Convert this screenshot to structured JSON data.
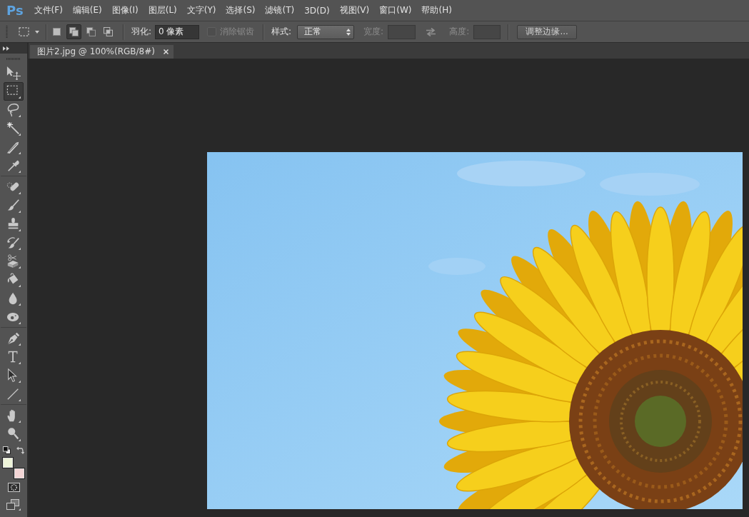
{
  "menu_bar": {
    "logo": "Ps",
    "items": [
      "文件(F)",
      "编辑(E)",
      "图像(I)",
      "图层(L)",
      "文字(Y)",
      "选择(S)",
      "滤镜(T)",
      "3D(D)",
      "视图(V)",
      "窗口(W)",
      "帮助(H)"
    ]
  },
  "options_bar": {
    "selection_modes": [
      {
        "kind": "new",
        "selected": false
      },
      {
        "kind": "add",
        "selected": true
      },
      {
        "kind": "subtract",
        "selected": false
      },
      {
        "kind": "intersect",
        "selected": false
      }
    ],
    "feather": {
      "label": "羽化:",
      "value": "0 像素"
    },
    "anti_alias": {
      "label": "消除锯齿",
      "checked": false,
      "disabled": true
    },
    "style": {
      "label": "样式:",
      "value": "正常"
    },
    "width": {
      "label": "宽度:",
      "disabled": true
    },
    "height": {
      "label": "高度:",
      "disabled": true
    },
    "refine_edge": {
      "label": "调整边缘..."
    }
  },
  "document_tabs": [
    {
      "title": "图片2.jpg @ 100%(RGB/8#)",
      "selected": true
    }
  ],
  "toolbox": {
    "tool_groups": [
      [
        {
          "kind": "move",
          "selected": false
        },
        {
          "kind": "marquee",
          "selected": true
        },
        {
          "kind": "lasso",
          "selected": false
        },
        {
          "kind": "wand",
          "selected": false
        },
        {
          "kind": "blade",
          "selected": false
        },
        {
          "kind": "eyedropper",
          "selected": false
        }
      ],
      [
        {
          "kind": "bandage",
          "selected": false
        },
        {
          "kind": "brush",
          "selected": false
        },
        {
          "kind": "stamp",
          "selected": false
        },
        {
          "kind": "history",
          "selected": false
        },
        {
          "kind": "eraser",
          "selected": false
        },
        {
          "kind": "bucket",
          "selected": false
        },
        {
          "kind": "drop",
          "selected": false
        },
        {
          "kind": "sponge",
          "selected": false
        }
      ],
      [
        {
          "kind": "pen",
          "selected": false
        },
        {
          "kind": "type",
          "selected": false
        },
        {
          "kind": "pointer",
          "selected": false
        },
        {
          "kind": "line",
          "selected": false
        }
      ],
      [
        {
          "kind": "hand",
          "selected": false
        },
        {
          "kind": "zoom",
          "selected": false
        }
      ]
    ],
    "colors": [
      {
        "kind": "foreground",
        "color": "#eef4d9"
      },
      {
        "kind": "background",
        "color": "#f3d5d5"
      }
    ]
  }
}
